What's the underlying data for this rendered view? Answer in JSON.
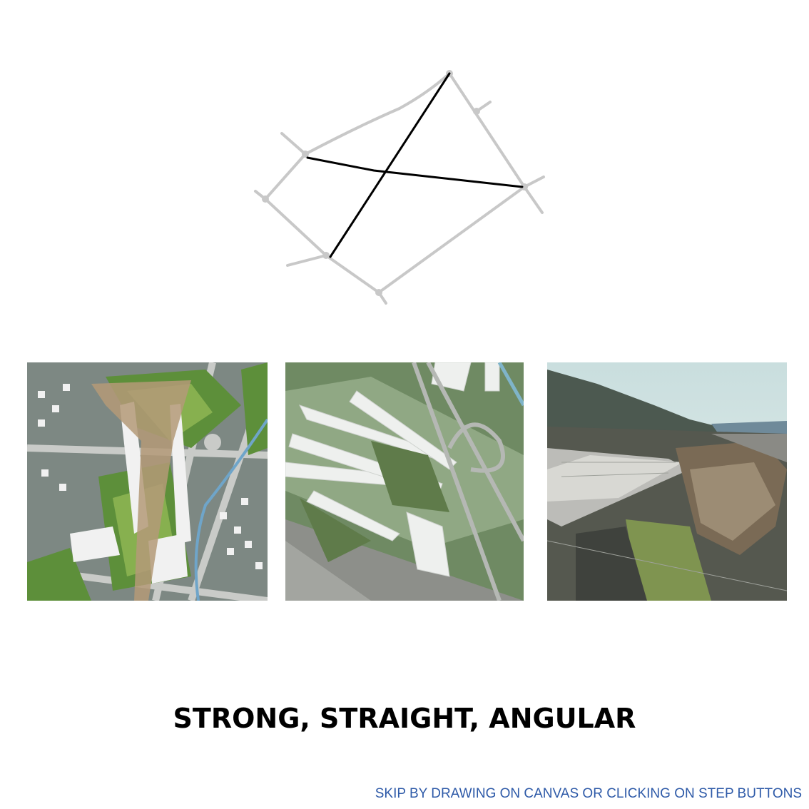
{
  "slide": {
    "headline": "STRONG, STRAIGHT, ANGULAR",
    "skip_link": "SKIP BY DRAWING ON CANVAS OR CLICKING ON STEP BUTTONS"
  },
  "colors": {
    "road_grey": "#c8c8c8",
    "axis_black": "#000000",
    "skip_link_blue": "#2e5aa8"
  },
  "images": [
    {
      "name": "masterplan-site-plan"
    },
    {
      "name": "masterplan-aerial-view"
    },
    {
      "name": "masterplan-perspective-render"
    }
  ]
}
